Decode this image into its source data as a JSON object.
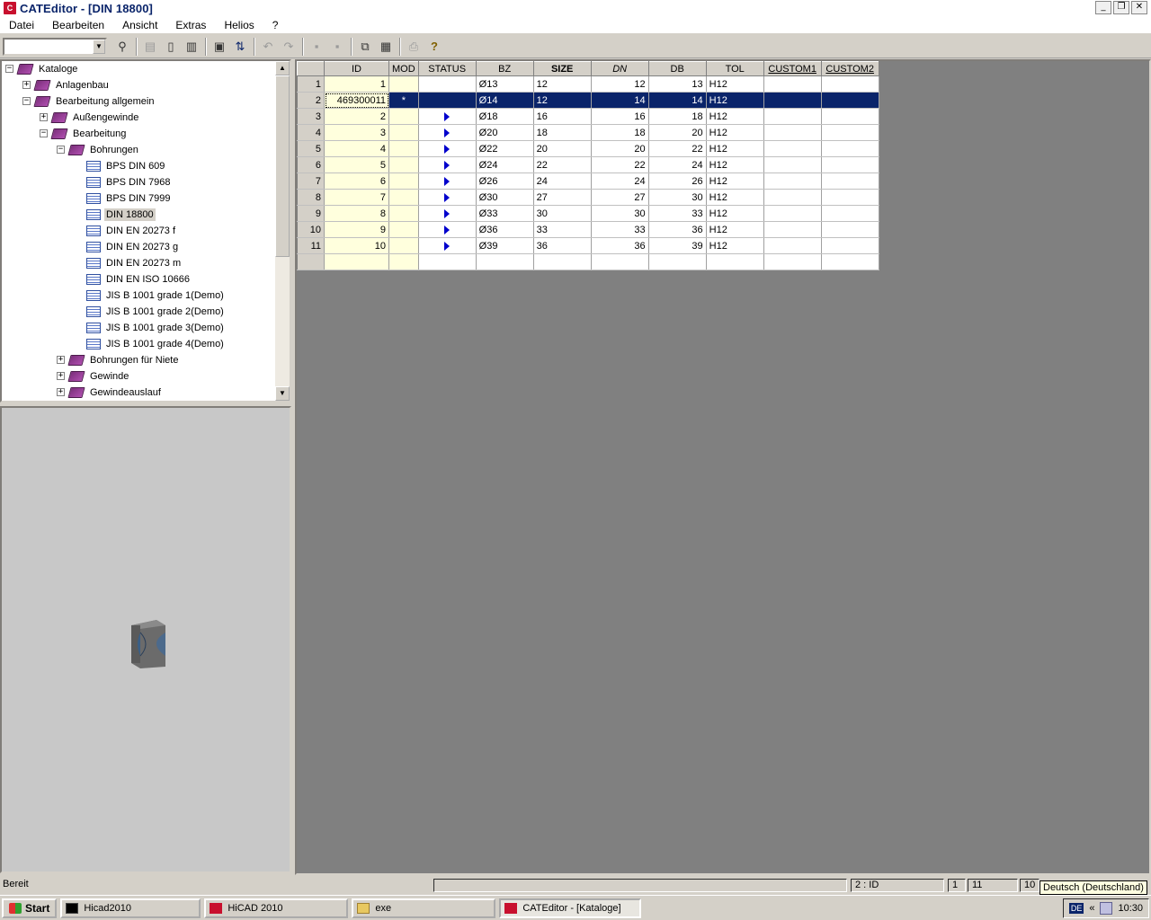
{
  "window": {
    "title": "CATEditor - [DIN 18800]",
    "app_icon": "C"
  },
  "menu": [
    {
      "label": "Datei"
    },
    {
      "label": "Bearbeiten"
    },
    {
      "label": "Ansicht"
    },
    {
      "label": "Extras"
    },
    {
      "label": "Helios"
    },
    {
      "label": "?"
    }
  ],
  "toolbar": {
    "search_value": "",
    "icons": [
      "find-icon",
      "export-icon",
      "new-doc-icon",
      "copy-table-icon",
      "save-icon",
      "sort-icon",
      "undo-icon",
      "redo-icon",
      "insert-row-icon",
      "delete-row-icon",
      "copy-icon",
      "paste-icon",
      "print-icon",
      "help-icon"
    ]
  },
  "tree": {
    "items": [
      {
        "label": "Kataloge",
        "level": 0,
        "expander": "−",
        "icon": "book"
      },
      {
        "label": "Anlagenbau",
        "level": 1,
        "expander": "+",
        "icon": "book"
      },
      {
        "label": "Bearbeitung allgemein",
        "level": 1,
        "expander": "−",
        "icon": "book"
      },
      {
        "label": "Außengewinde",
        "level": 2,
        "expander": "+",
        "icon": "book"
      },
      {
        "label": "Bearbeitung",
        "level": 2,
        "expander": "−",
        "icon": "book"
      },
      {
        "label": "Bohrungen",
        "level": 3,
        "expander": "−",
        "icon": "book"
      },
      {
        "label": "BPS DIN 609",
        "level": 4,
        "expander": "",
        "icon": "table"
      },
      {
        "label": "BPS DIN 7968",
        "level": 4,
        "expander": "",
        "icon": "table"
      },
      {
        "label": "BPS DIN 7999",
        "level": 4,
        "expander": "",
        "icon": "table"
      },
      {
        "label": "DIN 18800",
        "level": 4,
        "expander": "",
        "icon": "table",
        "selected": true
      },
      {
        "label": "DIN EN 20273 f",
        "level": 4,
        "expander": "",
        "icon": "table"
      },
      {
        "label": "DIN EN 20273 g",
        "level": 4,
        "expander": "",
        "icon": "table"
      },
      {
        "label": "DIN EN 20273 m",
        "level": 4,
        "expander": "",
        "icon": "table"
      },
      {
        "label": "DIN EN ISO 10666",
        "level": 4,
        "expander": "",
        "icon": "table"
      },
      {
        "label": "JIS B 1001 grade 1(Demo)",
        "level": 4,
        "expander": "",
        "icon": "table"
      },
      {
        "label": "JIS B 1001 grade 2(Demo)",
        "level": 4,
        "expander": "",
        "icon": "table"
      },
      {
        "label": "JIS B 1001 grade 3(Demo)",
        "level": 4,
        "expander": "",
        "icon": "table"
      },
      {
        "label": "JIS B 1001 grade 4(Demo)",
        "level": 4,
        "expander": "",
        "icon": "table"
      },
      {
        "label": "Bohrungen für Niete",
        "level": 3,
        "expander": "+",
        "icon": "book"
      },
      {
        "label": "Gewinde",
        "level": 3,
        "expander": "+",
        "icon": "book"
      },
      {
        "label": "Gewindeauslauf",
        "level": 3,
        "expander": "+",
        "icon": "book"
      }
    ]
  },
  "grid": {
    "columns": [
      "ID",
      "MOD",
      "STATUS",
      "BZ",
      "SIZE",
      "DN",
      "DB",
      "TOL",
      "CUSTOM1",
      "CUSTOM2"
    ],
    "rows": [
      {
        "n": "1",
        "id": "1",
        "mod": "",
        "status": false,
        "bz": "Ø13",
        "size": "12",
        "dn": "12",
        "db": "13",
        "tol": "H12"
      },
      {
        "n": "2",
        "id": "469300011",
        "mod": "*",
        "status": false,
        "bz": "Ø14",
        "size": "12",
        "dn": "14",
        "db": "14",
        "tol": "H12",
        "selected": true
      },
      {
        "n": "3",
        "id": "2",
        "mod": "",
        "status": true,
        "bz": "Ø18",
        "size": "16",
        "dn": "16",
        "db": "18",
        "tol": "H12"
      },
      {
        "n": "4",
        "id": "3",
        "mod": "",
        "status": true,
        "bz": "Ø20",
        "size": "18",
        "dn": "18",
        "db": "20",
        "tol": "H12"
      },
      {
        "n": "5",
        "id": "4",
        "mod": "",
        "status": true,
        "bz": "Ø22",
        "size": "20",
        "dn": "20",
        "db": "22",
        "tol": "H12"
      },
      {
        "n": "6",
        "id": "5",
        "mod": "",
        "status": true,
        "bz": "Ø24",
        "size": "22",
        "dn": "22",
        "db": "24",
        "tol": "H12"
      },
      {
        "n": "7",
        "id": "6",
        "mod": "",
        "status": true,
        "bz": "Ø26",
        "size": "24",
        "dn": "24",
        "db": "26",
        "tol": "H12"
      },
      {
        "n": "8",
        "id": "7",
        "mod": "",
        "status": true,
        "bz": "Ø30",
        "size": "27",
        "dn": "27",
        "db": "30",
        "tol": "H12"
      },
      {
        "n": "9",
        "id": "8",
        "mod": "",
        "status": true,
        "bz": "Ø33",
        "size": "30",
        "dn": "30",
        "db": "33",
        "tol": "H12"
      },
      {
        "n": "10",
        "id": "9",
        "mod": "",
        "status": true,
        "bz": "Ø36",
        "size": "33",
        "dn": "33",
        "db": "36",
        "tol": "H12"
      },
      {
        "n": "11",
        "id": "10",
        "mod": "",
        "status": true,
        "bz": "Ø39",
        "size": "36",
        "dn": "36",
        "db": "39",
        "tol": "H12"
      },
      {
        "n": "",
        "id": "",
        "mod": "",
        "status": false,
        "bz": "",
        "size": "",
        "dn": "",
        "db": "",
        "tol": "",
        "empty": true
      }
    ]
  },
  "statusbar": {
    "text": "Bereit",
    "field": "2 : ID",
    "row": "1",
    "count": "11",
    "extra": "10"
  },
  "tooltip": "Deutsch (Deutschland)",
  "taskbar": {
    "start": "Start",
    "tasks": [
      {
        "label": "Hicad2010",
        "active": false
      },
      {
        "label": "HiCAD 2010",
        "active": false
      },
      {
        "label": "exe",
        "active": false
      },
      {
        "label": "CATEditor - [Kataloge]",
        "active": true
      }
    ],
    "lang": "DE",
    "clock": "10:30"
  },
  "colors": {
    "selection": "#0a246a",
    "title": "#0a246a",
    "status_arrow": "#0000cc",
    "id_col": "#ffffdd"
  }
}
